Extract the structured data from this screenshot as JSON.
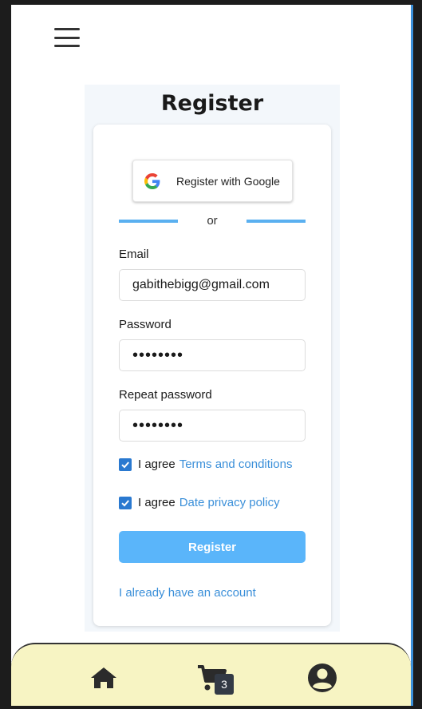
{
  "page": {
    "title": "Register"
  },
  "google": {
    "label": "Register with Google",
    "icon": "google-icon"
  },
  "divider": {
    "text": "or"
  },
  "form": {
    "email_label": "Email",
    "email_value": "gabithebigg@gmail.com",
    "password_label": "Password",
    "password_value": "••••••••",
    "repeat_label": "Repeat password",
    "repeat_value": "••••••••",
    "terms_prefix": "I agree",
    "terms_link": "Terms and conditions",
    "terms_checked": true,
    "privacy_prefix": "I agree",
    "privacy_link": "Date privacy policy",
    "privacy_checked": true,
    "submit_label": "Register",
    "login_link": "I already have an account"
  },
  "nav": {
    "items": [
      {
        "icon": "home-icon"
      },
      {
        "icon": "cart-icon"
      },
      {
        "icon": "user-icon"
      }
    ],
    "cart_count": "3"
  },
  "colors": {
    "accent": "#3a8fd9",
    "button": "#5ab5fa",
    "nav_background": "#f7f4c3",
    "checkbox": "#2a79d0"
  }
}
